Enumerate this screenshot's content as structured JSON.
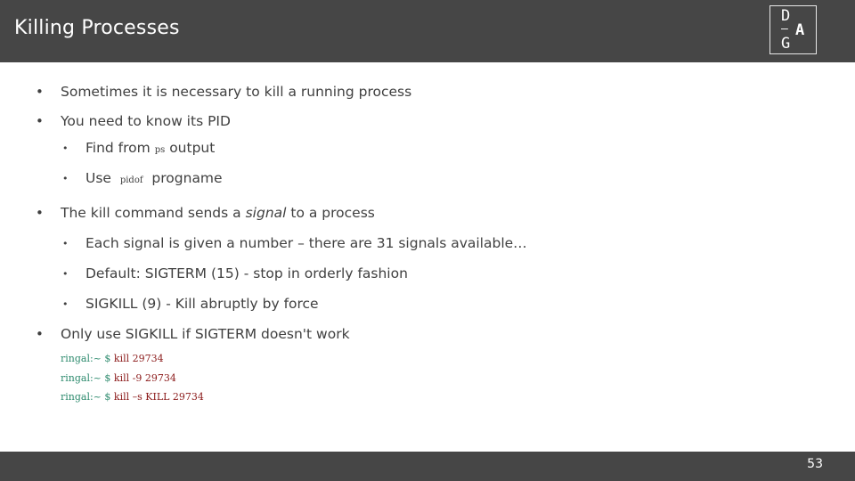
{
  "header": {
    "title": "Killing Processes",
    "logo": {
      "line1": "D",
      "dash": "–",
      "accent": "A",
      "line3": "G"
    }
  },
  "bullets": [
    {
      "level": 1,
      "text": "Sometimes it is necessary to kill a running process"
    },
    {
      "level": 1,
      "text": "You need to know its PID"
    },
    {
      "level": 2,
      "pre": "Find from",
      "code": "ps",
      "post": "output"
    },
    {
      "level": 2,
      "pre": "Use",
      "code": "pidof",
      "post": "progname"
    },
    {
      "level": 1,
      "pre": "The kill command sends a",
      "em": "signal",
      "post": "to a process"
    },
    {
      "level": 2,
      "text": "Each signal is given a number – there are 31 signals available…"
    },
    {
      "level": 2,
      "text": "Default: SIGTERM (15) - stop in orderly fashion"
    },
    {
      "level": 2,
      "text": "SIGKILL (9) - Kill abruptly by force"
    },
    {
      "level": 1,
      "text": "Only use SIGKILL if SIGTERM doesn't work"
    }
  ],
  "bullet_glyph": "•",
  "code_lines": [
    {
      "prompt": "ringal:~ $",
      "command": "kill 29734"
    },
    {
      "prompt": "ringal:~ $",
      "command": "kill -9 29734"
    },
    {
      "prompt": "ringal:~ $",
      "command": "kill –s KILL 29734"
    }
  ],
  "colors": {
    "header_bg": "#464646",
    "text": "#404040",
    "prompt": "#2e8b6e",
    "command": "#8b1a1a"
  },
  "footer": {
    "page_number": "53"
  }
}
